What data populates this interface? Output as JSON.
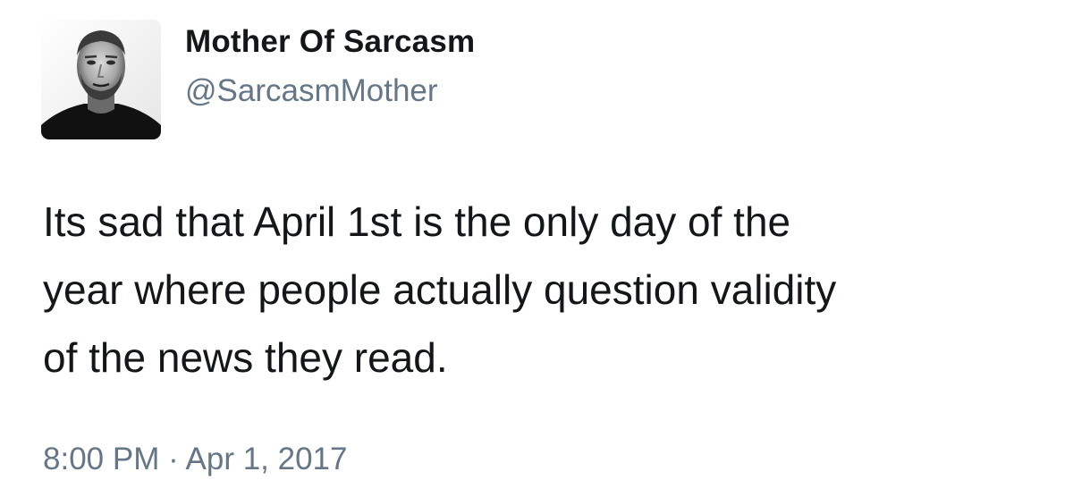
{
  "tweet": {
    "author": {
      "display_name": "Mother Of Sarcasm",
      "handle": "@SarcasmMother",
      "avatar_icon": "profile-photo"
    },
    "text_lines": [
      "Its sad that April 1st is the only day of the",
      "year where people actually question validity",
      "of the news they read."
    ],
    "timestamp": "8:00 PM · Apr 1, 2017"
  },
  "colors": {
    "text_primary": "#14171a",
    "text_secondary": "#657786",
    "background": "#ffffff"
  }
}
